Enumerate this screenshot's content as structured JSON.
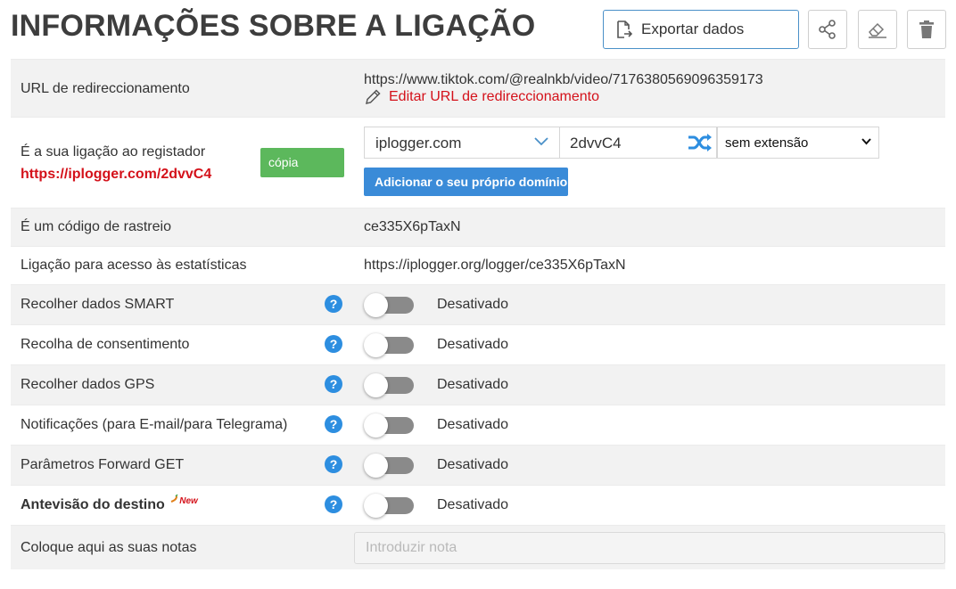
{
  "header": {
    "title": "INFORMAÇÕES SOBRE A LIGAÇÃO",
    "export_label": "Exportar dados",
    "share_icon": "share-icon",
    "erase_icon": "eraser-icon",
    "delete_icon": "trash-icon"
  },
  "redirect": {
    "label": "URL de redireccionamento",
    "url": "https://www.tiktok.com/@realnkb/video/7176380569096359173",
    "edit_label": "Editar URL de redireccionamento"
  },
  "logger": {
    "label": "É a sua ligação ao registador",
    "link": "https://iplogger.com/2dvvC4",
    "copy_label": "cópia",
    "domain": "iplogger.com",
    "code": "2dvvC4",
    "extension": "sem extensão",
    "add_domain_label": "Adicionar o seu próprio domínio"
  },
  "tracking": {
    "label": "É um código de rastreio",
    "value": "ce335X6pTaxN"
  },
  "stats": {
    "label": "Ligação para acesso às estatísticas",
    "value": "https://iplogger.org/logger/ce335X6pTaxN"
  },
  "settings": [
    {
      "label": "Recolher dados SMART",
      "status": "Desativado",
      "enabled": false
    },
    {
      "label": "Recolha de consentimento",
      "status": "Desativado",
      "enabled": false
    },
    {
      "label": "Recolher dados GPS",
      "status": "Desativado",
      "enabled": false
    },
    {
      "label": "Notificações (para E-mail/para Telegrama)",
      "status": "Desativado",
      "enabled": false
    },
    {
      "label": "Parâmetros Forward GET",
      "status": "Desativado",
      "enabled": false
    },
    {
      "label": "Antevisão do destino",
      "badge": "New",
      "status": "Desativado",
      "enabled": false
    }
  ],
  "help_glyph": "?",
  "notes": {
    "label": "Coloque aqui as suas notas",
    "placeholder": "Introduzir nota"
  },
  "colors": {
    "accent_blue": "#3a8bd8",
    "link_red": "#d4111a",
    "copy_green": "#5cb85c",
    "toggle_off": "#8a8a8a"
  }
}
